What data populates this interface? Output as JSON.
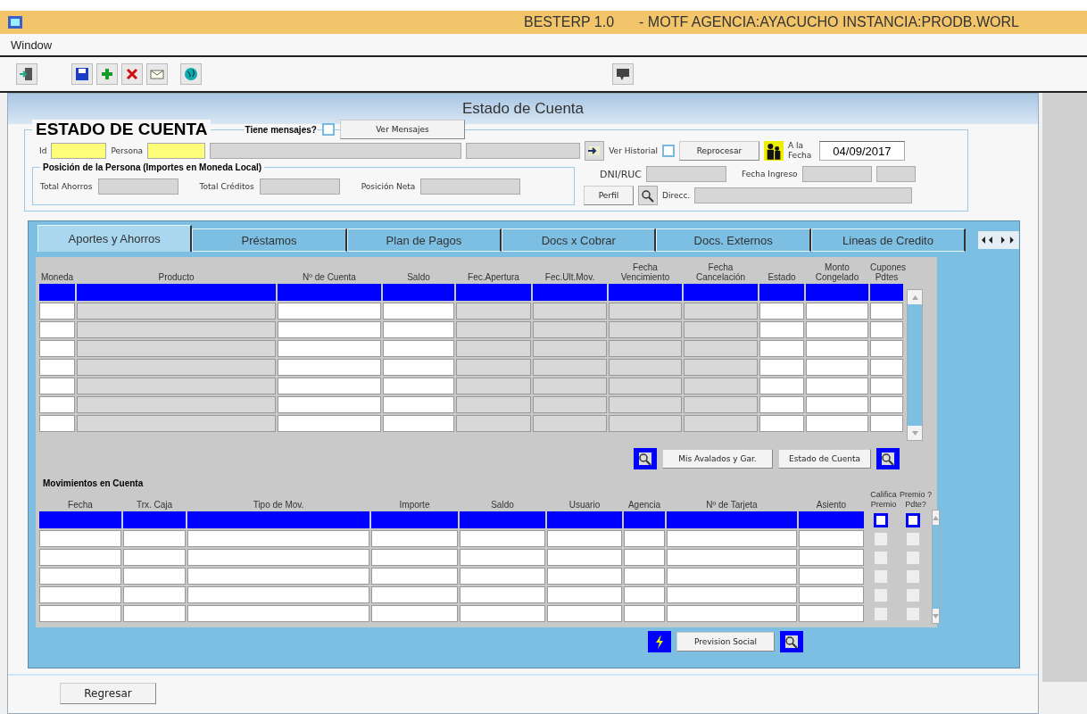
{
  "window": {
    "app": "BESTERP 1.0",
    "info": "- MOTF AGENCIA:AYACUCHO INSTANCIA:PRODB.WORL"
  },
  "menu": [
    "Window"
  ],
  "form": {
    "title": "Estado de Cuenta"
  },
  "header": {
    "heading": "ESTADO DE CUENTA",
    "messages": {
      "label": "Tiene mensajes?",
      "checked": false
    },
    "view_messages_button": "Ver Mensajes",
    "id_label": "Id",
    "persona_label": "Persona",
    "history": {
      "label": "Ver Historial",
      "checked": false
    },
    "reprocess_button": "Reprocesar",
    "date_label": "A la Fecha",
    "date_value": "04/09/2017",
    "position": {
      "title": "Posición de la Persona (Importes en Moneda Local)",
      "fields": [
        "Total Ahorros",
        "Total Créditos",
        "Posición Neta"
      ]
    },
    "dni_label": "DNI/RUC",
    "entry_date_label": "Fecha Ingreso",
    "profile_button": "Perfil",
    "address_label": "Direcc."
  },
  "tabs": [
    {
      "label": "Aportes y Ahorros",
      "selected": true
    },
    {
      "label": "Préstamos",
      "selected": false
    },
    {
      "label": "Plan de Pagos",
      "selected": false
    },
    {
      "label": "Docs x Cobrar",
      "selected": false
    },
    {
      "label": "Docs. Externos",
      "selected": false
    },
    {
      "label": "Lineas de Credito",
      "selected": false
    }
  ],
  "accounts": {
    "columns": [
      {
        "label": "Moneda",
        "disabled": false
      },
      {
        "label": "Producto",
        "disabled": true
      },
      {
        "label": "Nº de Cuenta",
        "disabled": false
      },
      {
        "label": "Saldo",
        "disabled": false
      },
      {
        "label": "Fec.Apertura",
        "disabled": true
      },
      {
        "label": "Fec.Ult.Mov.",
        "disabled": true
      },
      {
        "label": "Fecha Vencimiento",
        "disabled": true
      },
      {
        "label": "Fecha Cancelación",
        "disabled": true
      },
      {
        "label": "Estado",
        "disabled": false
      },
      {
        "label": "Monto Congelado",
        "disabled": false
      },
      {
        "label": "Cupones Pdtes",
        "disabled": false
      }
    ],
    "rows": [
      {
        "selected": true
      },
      {
        "selected": false
      },
      {
        "selected": false
      },
      {
        "selected": false
      },
      {
        "selected": false
      },
      {
        "selected": false
      },
      {
        "selected": false
      },
      {
        "selected": false
      }
    ]
  },
  "account_buttons": [
    "Mis Avalados y Gar.",
    "Estado de Cuenta"
  ],
  "movements": {
    "title": "Movimientos en Cuenta",
    "columns": [
      {
        "label": "Fecha",
        "kind": "text"
      },
      {
        "label": "Trx. Caja",
        "kind": "text"
      },
      {
        "label": "Tipo de Mov.",
        "kind": "text"
      },
      {
        "label": "Importe",
        "kind": "text"
      },
      {
        "label": "Saldo",
        "kind": "text"
      },
      {
        "label": "Usuario",
        "kind": "text"
      },
      {
        "label": "Agencia",
        "kind": "text"
      },
      {
        "label": "Nº de Tarjeta",
        "kind": "text"
      },
      {
        "label": "Asiento",
        "kind": "text"
      },
      {
        "label": "Califica Premio",
        "kind": "check"
      },
      {
        "label": "Premio ?Pdte?",
        "kind": "check"
      }
    ],
    "rows": [
      {
        "selected": true,
        "checks": [
          false,
          false
        ]
      },
      {
        "selected": false,
        "checks": [
          false,
          false
        ]
      },
      {
        "selected": false,
        "checks": [
          false,
          false
        ]
      },
      {
        "selected": false,
        "checks": [
          false,
          false
        ]
      },
      {
        "selected": false,
        "checks": [
          false,
          false
        ]
      },
      {
        "selected": false,
        "checks": [
          false,
          false
        ]
      }
    ]
  },
  "movement_buttons": [
    "Prevision Social"
  ],
  "footer": {
    "back_button": "Regresar"
  }
}
